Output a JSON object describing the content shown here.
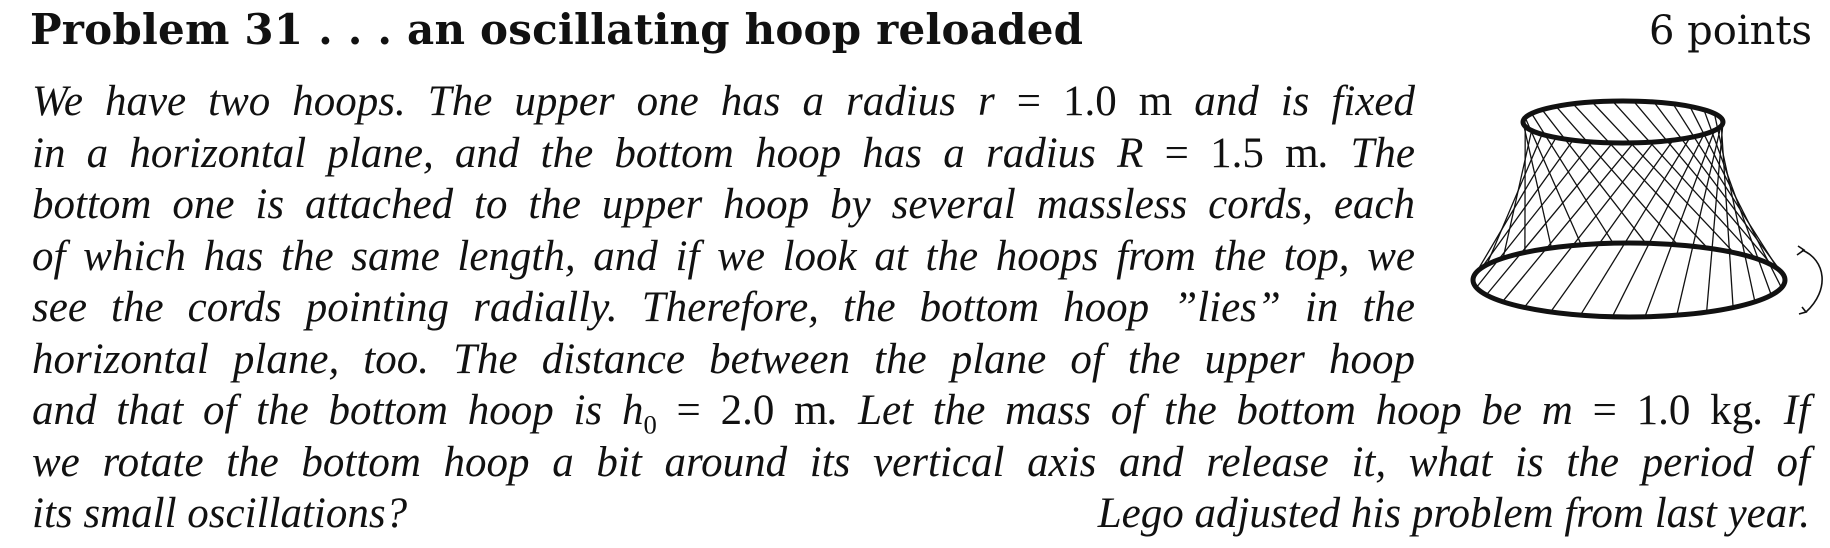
{
  "problem": {
    "title": "Problem 31 . . . an oscillating hoop reloaded",
    "points": "6 points"
  },
  "body": {
    "l1a": "We have two hoops. The upper one has a radius ",
    "l1var": "r",
    "l1eq": " = 1.0 m",
    "l1b": " and is fixed",
    "l2a": "in a horizontal plane, and the bottom hoop has a radius ",
    "l2var": "R",
    "l2eq": " = 1.5 m",
    "l2b": ". The",
    "l3": "bottom one is attached to the upper hoop by several massless cords, each",
    "l4": "of which has the same length, and if we look at the hoops from the top, we",
    "l5": "see the cords pointing radially. Therefore, the bottom hoop ”lies” in the",
    "l6": "horizontal plane, too. The distance between the plane of the upper hoop",
    "l7a": "and that of the bottom hoop is ",
    "l7var": "h",
    "l7sub": "0",
    "l7eq": " = 2.0 m",
    "l7b": ". Let the mass of the bottom hoop be ",
    "l7var2": "m",
    "l7eq2": " = 1.0 kg",
    "l7c": ". If",
    "l8": "we rotate the bottom hoop a bit around its vertical axis and release it, what is the period of",
    "l9": "its small oscillations?",
    "credit": "Lego adjusted his problem from last year."
  }
}
